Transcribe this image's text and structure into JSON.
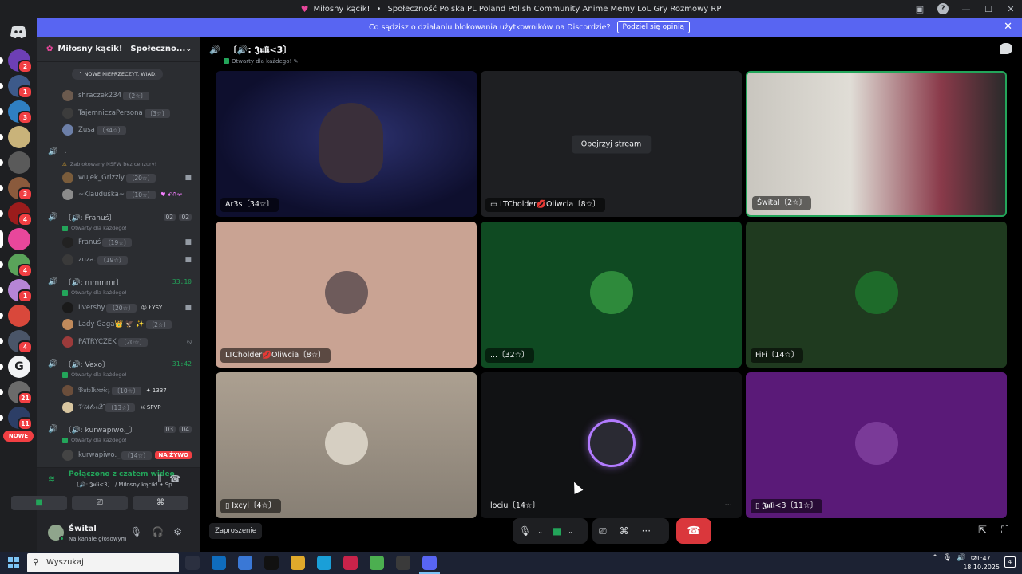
{
  "titlebar": {
    "server": "Miłosny kącik!",
    "separator": "•",
    "title": "Społeczność Polska PL Poland Polish Community Anime Memy LoL Gry Rozmowy RP"
  },
  "notice": {
    "text": "Co sądzisz o działaniu blokowania użytkowników na Discordzie?",
    "button": "Podziel się opinią"
  },
  "rail": {
    "badges": [
      "2",
      "1",
      "3",
      "3",
      "4",
      "4",
      "1",
      "4",
      "21",
      "11"
    ],
    "new_pill": "NOWE"
  },
  "sidebar": {
    "guild": "Miłosny kącik!",
    "guild_cut": "Społeczno...",
    "unread_pill": "NOWE NIEPRZECZYT. WIAD.",
    "top_users": [
      {
        "name": "shraczek234",
        "lvl": "〔2☆〕"
      },
      {
        "name": "TajemniczaPersona",
        "lvl": "〔3☆〕"
      },
      {
        "name": "Zusa",
        "lvl": "〔34☆〕"
      }
    ],
    "dot_channel": ".",
    "blocked_note": "Zablokowany NSFW bez cenzury!",
    "dot_users": [
      {
        "name": "wujek_Grizzly",
        "lvl": "〔20☆〕"
      },
      {
        "name": "~Klauduśka~",
        "lvl": "〔10☆〕",
        "tag": "♥ ꗃꗇꗁ"
      }
    ],
    "franus": {
      "name": "〔🔊: Franuś〕",
      "count_a": "02",
      "count_b": "02",
      "status": "Otwarty dla każdego!",
      "users": [
        {
          "name": "Franuś",
          "lvl": "〔19☆〕"
        },
        {
          "name": "zuza.",
          "lvl": "〔19☆〕"
        }
      ]
    },
    "mmmmr": {
      "name": "〔🔊: mmmmr〕",
      "timer": "33:10",
      "status": "Otwarty dla każdego!",
      "users": [
        {
          "name": "Iivershy",
          "lvl": "〔20☆〕",
          "tag": "😠 ŁYSY"
        },
        {
          "name": "Lady Gaga👑 🦅 ✨",
          "lvl": "〔2☆〕"
        },
        {
          "name": "PATRYCZEK",
          "lvl": "〔20☆〕"
        }
      ]
    },
    "vexo": {
      "name": "〔🔊: Vexo〕",
      "timer": "31:42",
      "status": "Otwarty dla każdego!",
      "users": [
        {
          "name": "𝔅𝔲𝔱𝔢𝔩𝔨𝔬𝔴𝔦𝔠𝔷",
          "lvl": "〔10☆〕",
          "tag": "✦ 1337"
        },
        {
          "name": "𝒱𝒾𝓀𝓉ℴ𝓇𝒳",
          "lvl": "〔13☆〕",
          "tag": "⚔ SPVP"
        }
      ]
    },
    "kurwapiwo": {
      "name": "〔🔊: kurwapiwo._〕",
      "count_a": "03",
      "count_b": "04",
      "status": "Otwarty dla każdego!",
      "users": [
        {
          "name": "kurwapiwo._",
          "lvl": "〔14☆〕",
          "live": "NA ŻYWO"
        }
      ]
    },
    "voice": {
      "status": "Połączono z czatem wideo",
      "sub": "〔🔊: 𝕵𝖚𝖑𝖎<3〕 / Miłosny kącik! • Sp..."
    },
    "user": {
      "name": "Śwital",
      "sub": "Na kanale głosowym"
    }
  },
  "stage": {
    "title": "〔🔊: 𝕵𝖚𝖑𝖎<3〕",
    "status": "Otwarty dla każdego!",
    "watch_button": "Obejrzyj stream",
    "tiles": [
      {
        "label": "Ar3s〔34☆〕"
      },
      {
        "label": "LTCholder💋Oliwcia〔8☆〕"
      },
      {
        "label": "Śwital〔2☆〕"
      },
      {
        "label": "LTCholder💋Oliwcia〔8☆〕"
      },
      {
        "label": "...〔32☆〕"
      },
      {
        "label": "FiFi〔14☆〕"
      },
      {
        "label": "Ixcyl〔4☆〕"
      },
      {
        "label": "lociu〔14☆〕"
      },
      {
        "label": "𝕵𝖚𝖑𝖎<3〔11☆〕"
      }
    ],
    "invite": "Zaproszenie"
  },
  "taskbar": {
    "search": "Wyszukaj",
    "time": "21:47",
    "date": "18.10.2025",
    "notif": "4"
  },
  "colors": {
    "accent": "#5865f2",
    "green": "#23a55a",
    "danger": "#da373c"
  }
}
